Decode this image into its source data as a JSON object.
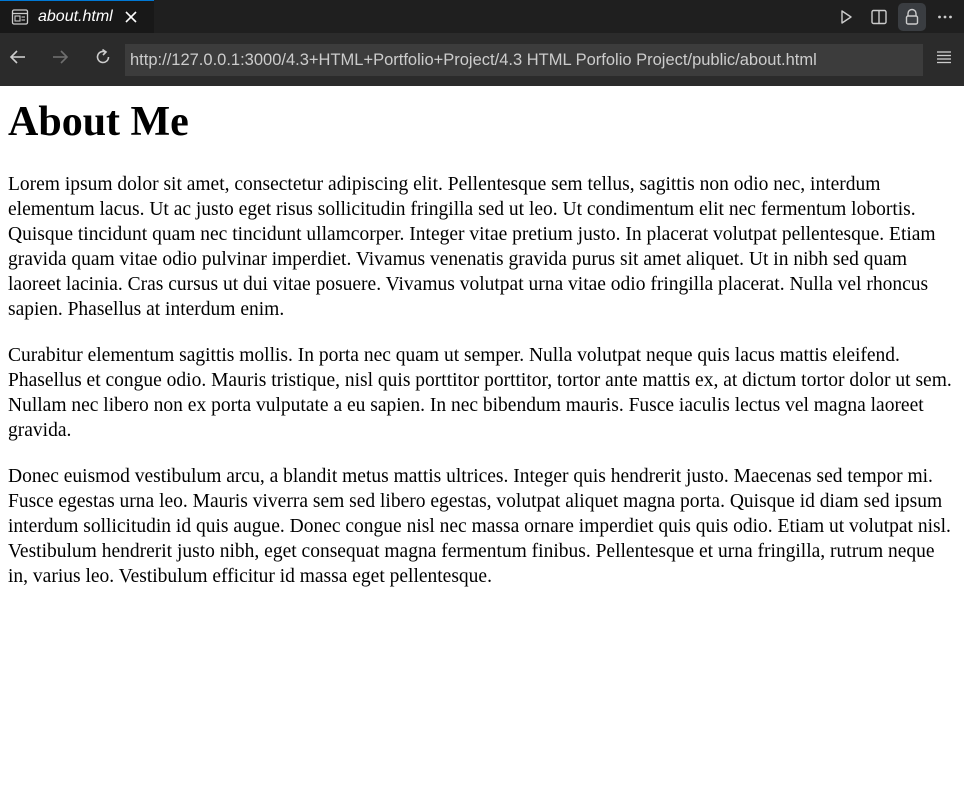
{
  "tab": {
    "title": "about.html",
    "icon": "preview-icon",
    "close_icon": "close-icon"
  },
  "toolbar": {
    "actions": [
      "run-icon",
      "split-editor-icon",
      "lock-icon",
      "more-actions-icon"
    ]
  },
  "navigation": {
    "url": "http://127.0.0.1:3000/4.3+HTML+Portfolio+Project/4.3 HTML Porfolio Project/public/about.html"
  },
  "page": {
    "heading": "About Me",
    "paragraphs": [
      "Lorem ipsum dolor sit amet, consectetur adipiscing elit. Pellentesque sem tellus, sagittis non odio nec, interdum elementum lacus. Ut ac justo eget risus sollicitudin fringilla sed ut leo. Ut condimentum elit nec fermentum lobortis. Quisque tincidunt quam nec tincidunt ullamcorper. Integer vitae pretium justo. In placerat volutpat pellentesque. Etiam gravida quam vitae odio pulvinar imperdiet. Vivamus venenatis gravida purus sit amet aliquet. Ut in nibh sed quam laoreet lacinia. Cras cursus ut dui vitae posuere. Vivamus volutpat urna vitae odio fringilla placerat. Nulla vel rhoncus sapien. Phasellus at interdum enim.",
      "Curabitur elementum sagittis mollis. In porta nec quam ut semper. Nulla volutpat neque quis lacus mattis eleifend. Phasellus et congue odio. Mauris tristique, nisl quis porttitor porttitor, tortor ante mattis ex, at dictum tortor dolor ut sem. Nullam nec libero non ex porta vulputate a eu sapien. In nec bibendum mauris. Fusce iaculis lectus vel magna laoreet gravida.",
      "Donec euismod vestibulum arcu, a blandit metus mattis ultrices. Integer quis hendrerit justo. Maecenas sed tempor mi. Fusce egestas urna leo. Mauris viverra sem sed libero egestas, volutpat aliquet magna porta. Quisque id diam sed ipsum interdum sollicitudin id quis augue. Donec congue nisl nec massa ornare imperdiet quis quis odio. Etiam ut volutpat nisl. Vestibulum hendrerit justo nibh, eget consequat magna fermentum finibus. Pellentesque et urna fringilla, rutrum neque in, varius leo. Vestibulum efficitur id massa eget pellentesque."
    ]
  },
  "colors": {
    "tabbar_bg": "#1f1f1f",
    "navbar_bg": "#2b2b2b",
    "url_field_bg": "#3c3c3c",
    "icon_color": "#cccccc",
    "page_bg": "#ffffff"
  }
}
